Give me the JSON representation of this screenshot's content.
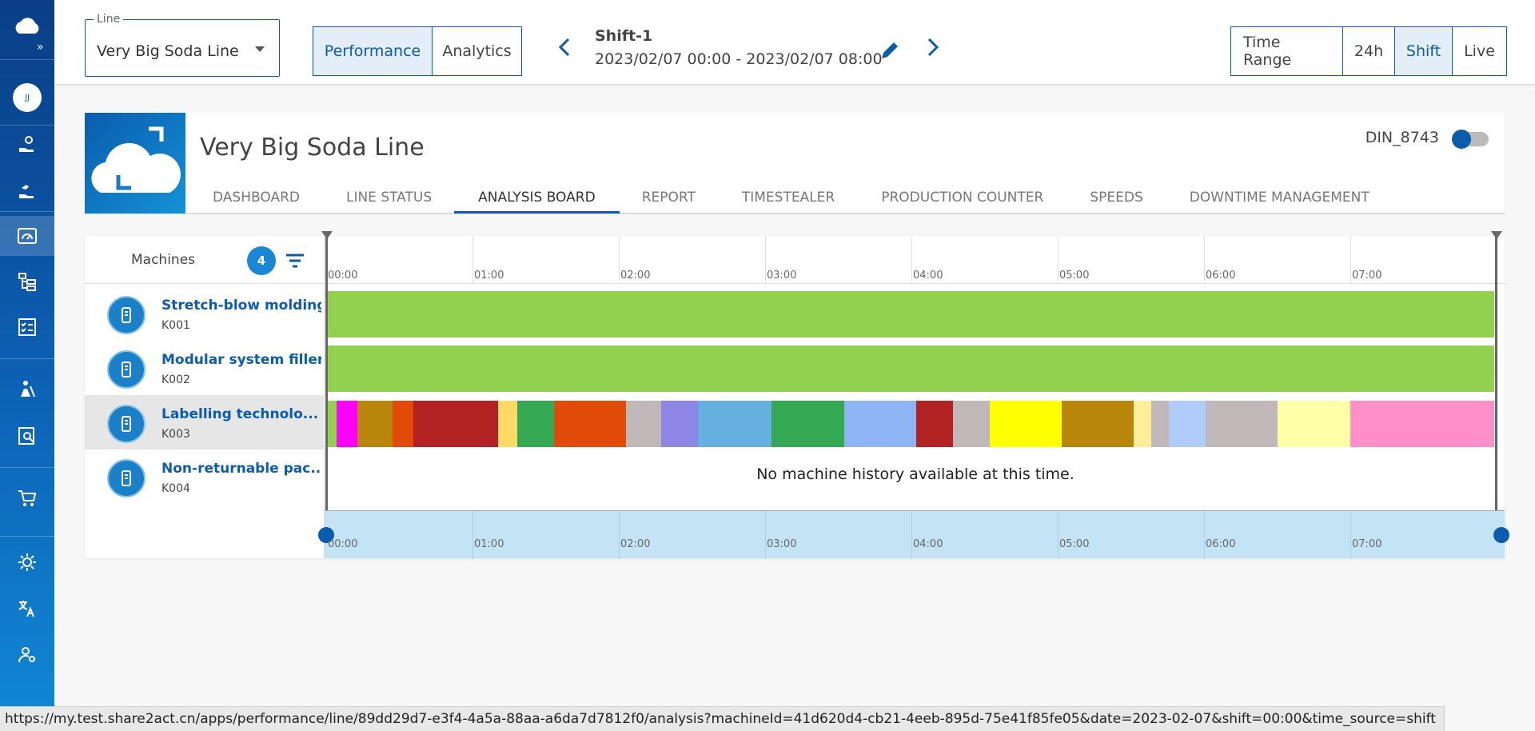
{
  "sidebar": {
    "initials": "JJ",
    "items": [
      {
        "icon": "hand-gear-icon"
      },
      {
        "icon": "hand-wave-icon"
      },
      {
        "icon": "gauge-icon",
        "active": true
      },
      {
        "icon": "tree-structure-icon"
      },
      {
        "icon": "checklist-icon"
      },
      {
        "icon": "person-climb-icon"
      },
      {
        "icon": "report-search-icon"
      },
      {
        "icon": "cart-icon"
      },
      {
        "icon": "brightness-icon"
      },
      {
        "icon": "translate-icon"
      },
      {
        "icon": "user-settings-icon"
      }
    ]
  },
  "header": {
    "line_field_label": "Line",
    "line_value": "Very Big Soda Line",
    "view_tabs": [
      "Performance",
      "Analytics"
    ],
    "shift_title": "Shift-1",
    "shift_range": "2023/02/07 00:00 - 2023/02/07 08:00",
    "time_tabs": [
      "Time Range",
      "24h",
      "Shift",
      "Live"
    ]
  },
  "card": {
    "title": "Very Big Soda Line",
    "tabs": [
      "DASHBOARD",
      "LINE STATUS",
      "ANALYSIS BOARD",
      "REPORT",
      "TIMESTEALER",
      "PRODUCTION COUNTER",
      "SPEEDS",
      "DOWNTIME MANAGEMENT"
    ],
    "active_tab": "ANALYSIS BOARD",
    "device": "DIN_8743"
  },
  "machines": {
    "header": "Machines",
    "count": "4",
    "list": [
      {
        "name": "Stretch-blow molding",
        "code": "K001",
        "icon": "blow-mold-icon"
      },
      {
        "name": "Modular system filler",
        "code": "K002",
        "icon": "filler-icon"
      },
      {
        "name": "Labelling technolo...",
        "code": "K003",
        "icon": "labeller-icon",
        "selected": true
      },
      {
        "name": "Non-returnable pac...",
        "code": "K004",
        "icon": "bottle-icon"
      }
    ]
  },
  "timeline": {
    "hours": [
      "00:00",
      "01:00",
      "02:00",
      "03:00",
      "04:00",
      "05:00",
      "06:00",
      "07:00"
    ],
    "no_history": "No machine history available at this time.",
    "running_color": "#92d050",
    "k003_segments": [
      [
        "#92d050",
        0.7
      ],
      [
        "#ff00ff",
        1.4
      ],
      [
        "#b8860b",
        2.4
      ],
      [
        "#e24a0a",
        1.4
      ],
      [
        "#b22222",
        5.8
      ],
      [
        "#ffd966",
        1.3
      ],
      [
        "#34a853",
        2.5
      ],
      [
        "#e24a0a",
        4.9
      ],
      [
        "#c0b8b8",
        1.2
      ],
      [
        "#c0b8b8",
        1.2
      ],
      [
        "#8e86e6",
        2.5
      ],
      [
        "#66b0e0",
        5.0
      ],
      [
        "#34a853",
        4.9
      ],
      [
        "#8fb4f4",
        4.9
      ],
      [
        "#b22222",
        2.5
      ],
      [
        "#c0b8b8",
        2.5
      ],
      [
        "#ffff00",
        4.9
      ],
      [
        "#b8860b",
        4.9
      ],
      [
        "#ffee99",
        1.2
      ],
      [
        "#c0b8b8",
        1.2
      ],
      [
        "#b0ccf8",
        2.5
      ],
      [
        "#c0b8b8",
        4.9
      ],
      [
        "#ffffaa",
        4.9
      ],
      [
        "#ff8fc8",
        9.8
      ]
    ]
  },
  "status_url": "https://my.test.share2act.cn/apps/performance/line/89dd29d7-e3f4-4a5a-88aa-a6da7d7812f0/analysis?machineId=41d620d4-cb21-4eeb-895d-75e41f85fe05&date=2023-02-07&shift=00:00&time_source=shift"
}
